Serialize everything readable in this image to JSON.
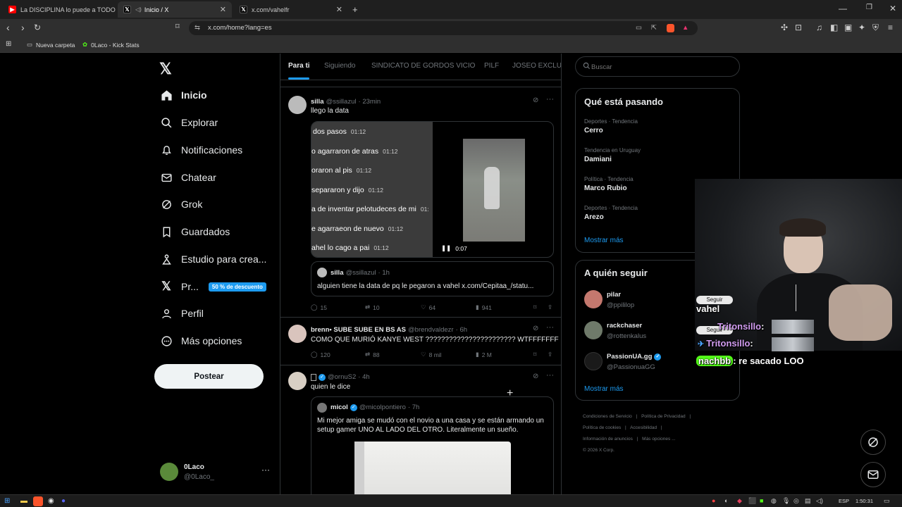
{
  "browser": {
    "tabs": [
      {
        "title": "La DISCIPLINA lo puede a TODO - EL",
        "active": false
      },
      {
        "title": "Inicio / X",
        "active": true
      },
      {
        "title": "x.com/vahelfr",
        "active": false
      }
    ],
    "url": "x.com/home?lang=es",
    "bookmarks": [
      "Nueva carpeta",
      "0Laco - Kick Stats"
    ]
  },
  "sidebar": {
    "items": [
      {
        "label": "Inicio",
        "icon": "home-icon"
      },
      {
        "label": "Explorar",
        "icon": "search-icon"
      },
      {
        "label": "Notificaciones",
        "icon": "bell-icon"
      },
      {
        "label": "Chatear",
        "icon": "mail-icon"
      },
      {
        "label": "Grok",
        "icon": "grok-icon"
      },
      {
        "label": "Guardados",
        "icon": "bookmark-icon"
      },
      {
        "label": "Estudio para crea...",
        "icon": "studio-icon"
      },
      {
        "label": "Pr...",
        "icon": "x-logo-icon"
      },
      {
        "label": "Perfil",
        "icon": "person-icon"
      },
      {
        "label": "Más opciones",
        "icon": "more-circle-icon"
      }
    ],
    "premium_badge": "50 % de descuento",
    "post_button": "Postear",
    "account": {
      "name": "0Laco",
      "handle": "@0Laco_"
    }
  },
  "timeline": {
    "tabs": [
      "Para ti",
      "Siguiendo",
      "SINDICATO DE GORDOS VICIO",
      "PILF",
      "JOSEO EXCLUSI"
    ],
    "tweets": [
      {
        "name": "silla",
        "handle": "@ssillazul",
        "time": "· 23min",
        "text": "llego la data",
        "video_lines": [
          {
            "t": "dos pasos",
            "ts": "01:12"
          },
          {
            "t": "o agarraron de atras",
            "ts": "01:12"
          },
          {
            "t": "oraron al pis",
            "ts": "01:12"
          },
          {
            "t": "separaron y dijo",
            "ts": "01:12"
          },
          {
            "t": "a de inventar pelotudeces de mi",
            "ts": "01:"
          },
          {
            "t": "e agarraeon de nuevo",
            "ts": "01:12"
          },
          {
            "t": "ahel lo cago a pai",
            "ts": "01:12"
          }
        ],
        "video_time": "0:07",
        "quote": {
          "name": "silla",
          "handle": "@ssillazul",
          "time": "· 1h",
          "text": "alguien tiene la data de pq le pegaron a vahel x.com/Cepitaa_/statu..."
        },
        "stats": {
          "replies": "15",
          "reposts": "10",
          "likes": "64",
          "views": "941"
        }
      },
      {
        "name": "brenn• SUBE SUBE EN BS AS",
        "handle": "@brendvaldezr",
        "time": "· 6h",
        "text": "COMO QUE MURIÓ KANYE WEST ??????????????????????? WTFFFFFFF",
        "stats": {
          "replies": "120",
          "reposts": "88",
          "likes": "8 mil",
          "views": "2 M"
        }
      },
      {
        "name": "",
        "handle": "@ornuS2",
        "time": "· 4h",
        "text": "quien le dice",
        "quote": {
          "name": "micol",
          "handle": "@micolpontiero",
          "time": "· 7h",
          "text": "Mi mejor amiga se mudó con el novio a una casa y se están armando un setup gamer UNO AL LADO DEL OTRO. Literalmente un sueño."
        }
      }
    ]
  },
  "right": {
    "search_placeholder": "Buscar",
    "trends_title": "Qué está pasando",
    "trends": [
      {
        "category": "Deportes · Tendencia",
        "name": "Cerro"
      },
      {
        "category": "Tendencia en Uruguay",
        "name": "Damiani"
      },
      {
        "category": "Política · Tendencia",
        "name": "Marco Rubio"
      },
      {
        "category": "Deportes · Tendencia",
        "name": "Arezo"
      }
    ],
    "show_more": "Mostrar más",
    "follow_title": "A quién seguir",
    "follow": [
      {
        "name": "pilar",
        "handle": "@ppililop"
      },
      {
        "name": "rackchaser",
        "handle": "@rottenkalus"
      },
      {
        "name": "PassionUA.gg",
        "handle": "@PassionuaGG"
      }
    ],
    "follow_button": "Seguir",
    "footer": [
      "Condiciones de Servicio",
      "Política de Privacidad",
      "Política de cookies",
      "Accesibilidad",
      "Información de anuncios",
      "Más opciones ...",
      "© 2026 X Corp."
    ]
  },
  "overlay": {
    "chat": [
      {
        "user": "vahel",
        "msg": ""
      },
      {
        "user": "Tritonsillo",
        "msg": ":"
      },
      {
        "user": "Tritonsillo",
        "msg": ":"
      },
      {
        "user": "nachbb",
        "msg": ": re sacado LOO"
      }
    ]
  },
  "taskbar": {
    "lang": "ESP",
    "time": "1:50:31"
  }
}
